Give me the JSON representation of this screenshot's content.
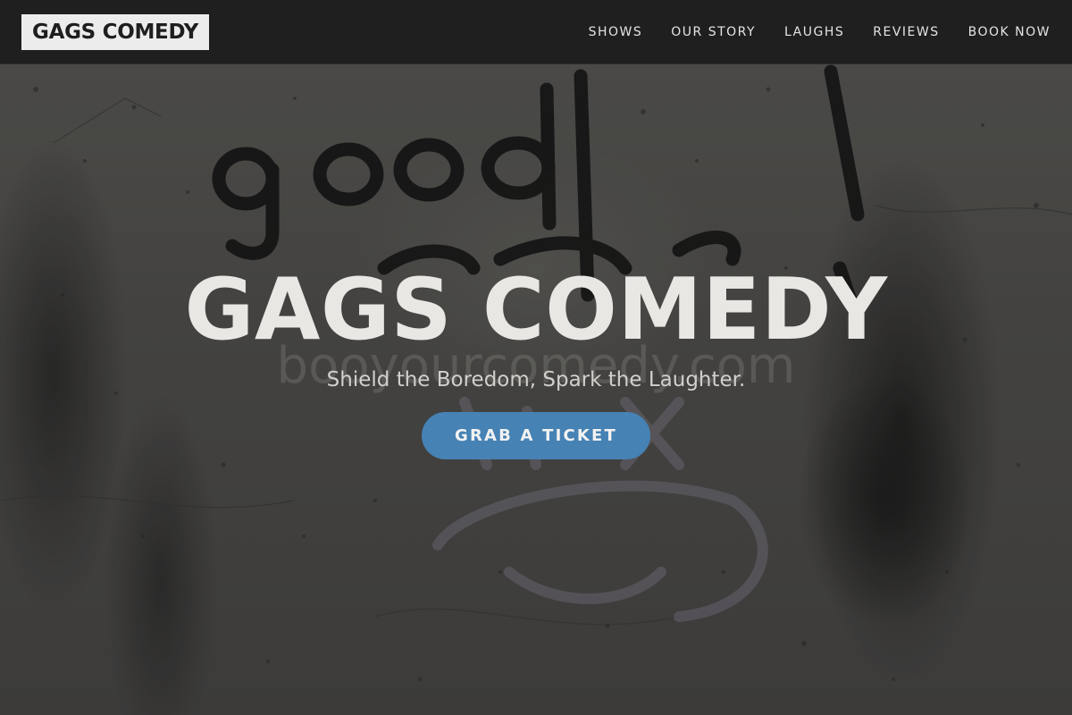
{
  "navbar": {
    "brand": "GAGS COMEDY",
    "links": [
      {
        "label": "SHOWS"
      },
      {
        "label": "OUR STORY"
      },
      {
        "label": "LAUGHS"
      },
      {
        "label": "REVIEWS"
      },
      {
        "label": "BOOK NOW"
      }
    ]
  },
  "hero": {
    "title": "GAGS COMEDY",
    "watermark": "booyourcomedy.com",
    "subtitle": "Shield the Boredom, Spark the Laughter.",
    "cta_label": "GRAB A TICKET"
  },
  "colors": {
    "navbar_bg": "#1f1f1f",
    "brand_bg": "#ececec",
    "accent": "#4682b4",
    "title_text": "#e9e7e4"
  }
}
